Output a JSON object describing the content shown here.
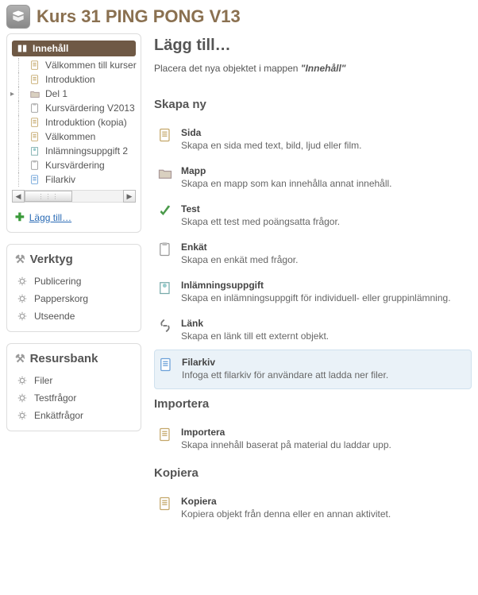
{
  "header": {
    "title": "Kurs 31 PING PONG V13"
  },
  "sidebar": {
    "tree": {
      "root": "Innehåll",
      "items": [
        {
          "label": "Välkommen till kurser",
          "icon": "page"
        },
        {
          "label": "Introduktion",
          "icon": "page"
        },
        {
          "label": "Del 1",
          "icon": "folder",
          "expandable": true
        },
        {
          "label": "Kursvärdering V2013",
          "icon": "survey"
        },
        {
          "label": "Introduktion (kopia)",
          "icon": "page"
        },
        {
          "label": "Välkommen",
          "icon": "page"
        },
        {
          "label": "Inlämningsuppgift 2",
          "icon": "assignment"
        },
        {
          "label": "Kursvärdering",
          "icon": "survey"
        },
        {
          "label": "Filarkiv",
          "icon": "filearchive"
        }
      ]
    },
    "add_link": "Lägg till…",
    "verktyg_title": "Verktyg",
    "verktyg_items": [
      "Publicering",
      "Papperskorg",
      "Utseende"
    ],
    "resursbank_title": "Resursbank",
    "resursbank_items": [
      "Filer",
      "Testfrågor",
      "Enkätfrågor"
    ]
  },
  "main": {
    "title": "Lägg till…",
    "breadcrumb_prefix": "Placera det nya objektet i mappen ",
    "breadcrumb_folder": "\"Innehåll\"",
    "sections": {
      "skapa_ny": {
        "title": "Skapa ny",
        "options": [
          {
            "icon": "page",
            "label": "Sida",
            "desc": "Skapa en sida med text, bild, ljud eller film."
          },
          {
            "icon": "folder",
            "label": "Mapp",
            "desc": "Skapa en mapp som kan innehålla annat innehåll."
          },
          {
            "icon": "test",
            "label": "Test",
            "desc": "Skapa ett test med poängsatta frågor."
          },
          {
            "icon": "survey",
            "label": "Enkät",
            "desc": "Skapa en enkät med frågor."
          },
          {
            "icon": "assignment",
            "label": "Inlämningsuppgift",
            "desc": "Skapa en inlämningsuppgift för individuell- eller gruppinlämning."
          },
          {
            "icon": "link",
            "label": "Länk",
            "desc": "Skapa en länk till ett externt objekt."
          },
          {
            "icon": "filearchive",
            "label": "Filarkiv",
            "desc": "Infoga ett filarkiv för användare att ladda ner filer.",
            "highlighted": true
          }
        ]
      },
      "importera": {
        "title": "Importera",
        "options": [
          {
            "icon": "page",
            "label": "Importera",
            "desc": "Skapa innehåll baserat på material du laddar upp."
          }
        ]
      },
      "kopiera": {
        "title": "Kopiera",
        "options": [
          {
            "icon": "page",
            "label": "Kopiera",
            "desc": "Kopiera objekt från denna eller en annan aktivitet."
          }
        ]
      }
    }
  }
}
